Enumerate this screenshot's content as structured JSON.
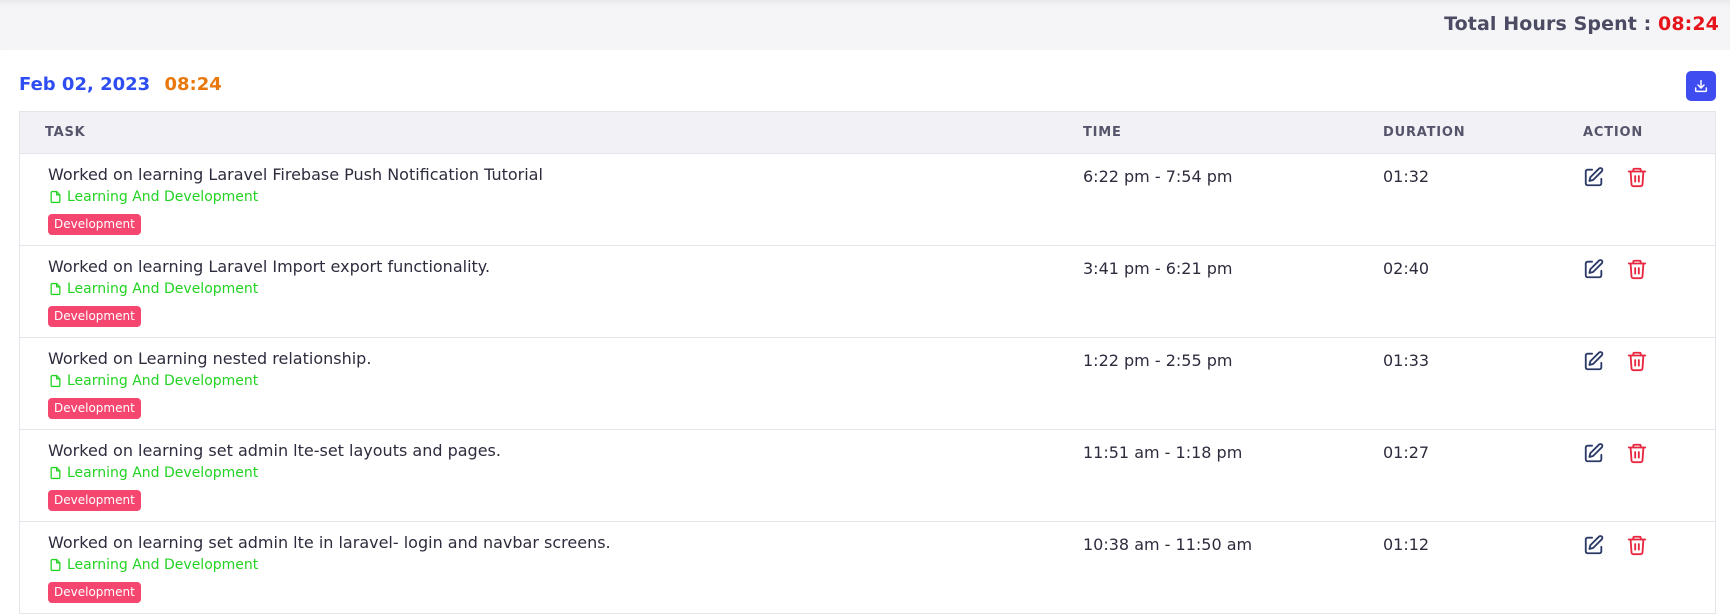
{
  "summary": {
    "label": "Total Hours Spent : ",
    "value": "08:24"
  },
  "day": {
    "date": "Feb 02, 2023",
    "hours": "08:24",
    "download_icon": "download-icon"
  },
  "columns": {
    "task": "TASK",
    "time": "TIME",
    "duration": "DURATION",
    "action": "ACTION"
  },
  "colors": {
    "date": "#2f4ef2",
    "hours": "#e8770c",
    "total": "#e6151c",
    "project": "#23d323",
    "tag": "#f5466f",
    "primary": "#3e4cf0",
    "delete": "#e8263f"
  },
  "rows": [
    {
      "title": "Worked on learning Laravel Firebase Push Notification Tutorial",
      "project": "Learning And Development",
      "tag": "Development",
      "time": "6:22 pm - 7:54 pm",
      "duration": "01:32"
    },
    {
      "title": "Worked on learning Laravel Import export functionality.",
      "project": "Learning And Development",
      "tag": "Development",
      "time": "3:41 pm - 6:21 pm",
      "duration": "02:40"
    },
    {
      "title": "Worked on Learning nested relationship.",
      "project": "Learning And Development",
      "tag": "Development",
      "time": "1:22 pm - 2:55 pm",
      "duration": "01:33"
    },
    {
      "title": "Worked on learning set admin lte-set layouts and pages.",
      "project": "Learning And Development",
      "tag": "Development",
      "time": "11:51 am - 1:18 pm",
      "duration": "01:27"
    },
    {
      "title": "Worked on learning set admin lte in laravel- login and navbar screens.",
      "project": "Learning And Development",
      "tag": "Development",
      "time": "10:38 am - 11:50 am",
      "duration": "01:12"
    }
  ]
}
